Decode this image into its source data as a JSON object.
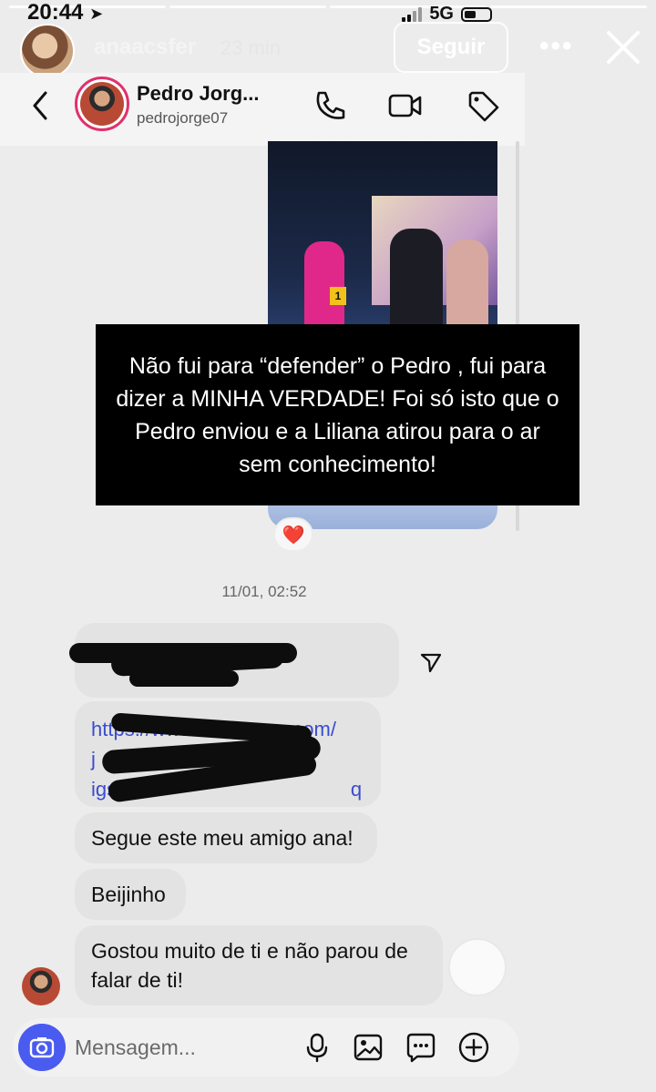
{
  "status_bar": {
    "time": "20:44",
    "network": "5G"
  },
  "story": {
    "username": "anaacsfer",
    "age": "23 min",
    "follow_label": "Seguir",
    "more_label": "•••"
  },
  "chat": {
    "contact_name": "Pedro Jorg...",
    "contact_handle": "pedrojorge07",
    "caption": "Não fui para “defender” o Pedro , fui para dizer a MINHA VERDADE! Foi só isto que o Pedro enviou e a Liliana atirou para o ar sem conhecimento!",
    "media_badge": "1",
    "reaction": "❤️",
    "timestamp": "11/01, 02:52",
    "link_lines": [
      "https://www.instagram.com/",
      "j",
      "igs                                          q"
    ],
    "messages": [
      "Segue este meu amigo ana!",
      "Beijinho",
      "Gostou muito de ti e não parou de falar de ti!"
    ]
  },
  "composer": {
    "placeholder": "Mensagem..."
  },
  "colors": {
    "accent": "#4a5bf0",
    "link": "#3b4bd1",
    "bubble": "#e3e3e3",
    "caption_bg": "#000000"
  }
}
